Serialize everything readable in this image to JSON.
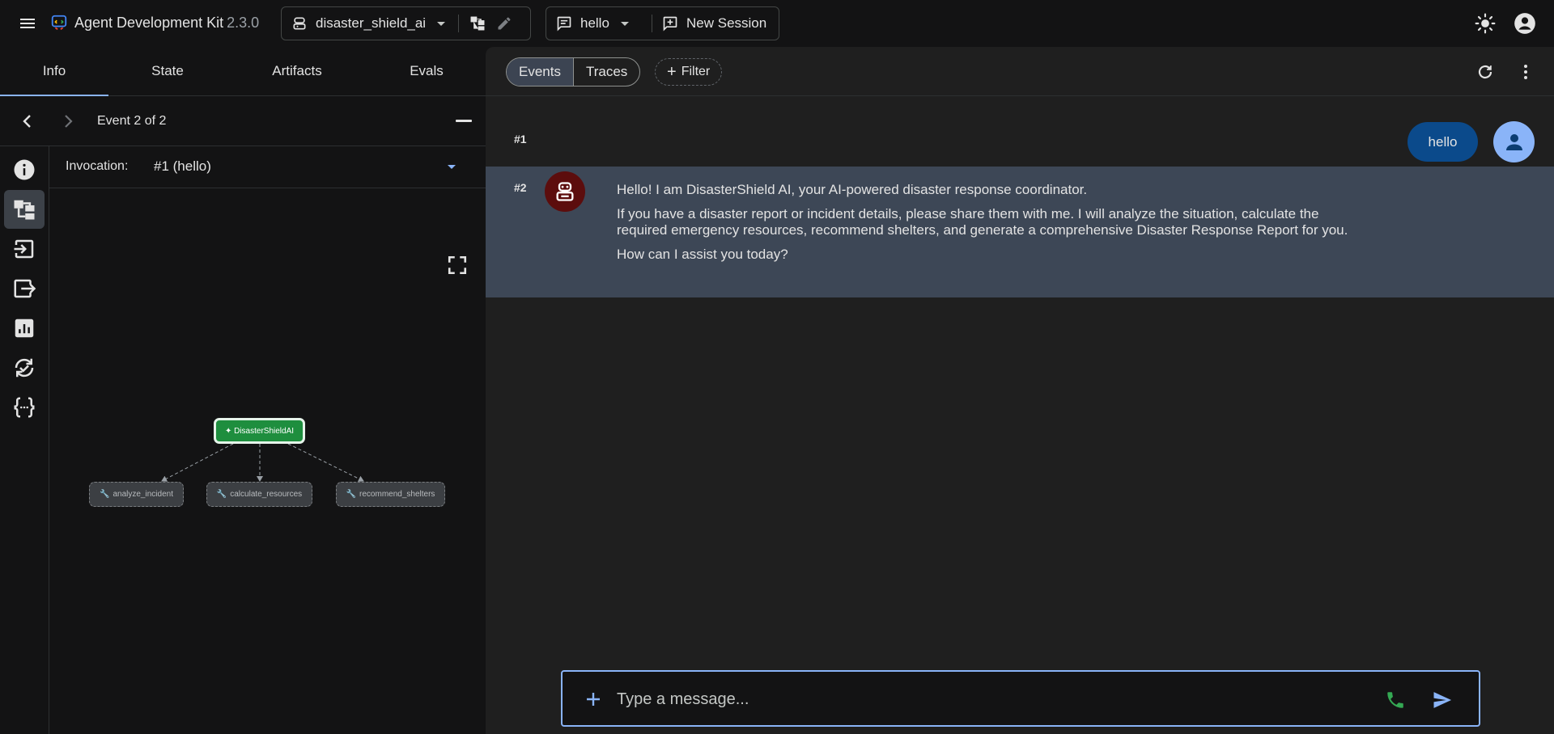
{
  "header": {
    "app_name": "Agent Development Kit",
    "version": "2.3.0",
    "agent": "disaster_shield_ai",
    "session": "hello",
    "new_session_label": "New Session"
  },
  "left": {
    "tabs": [
      {
        "label": "Info",
        "active": true
      },
      {
        "label": "State",
        "active": false
      },
      {
        "label": "Artifacts",
        "active": false
      },
      {
        "label": "Evals",
        "active": false
      }
    ],
    "event_label": "Event 2 of 2",
    "invocation_label": "Invocation:",
    "invocation_value": "#1 (hello)",
    "sidebar_icons": [
      "info-icon",
      "graph-icon",
      "input-icon",
      "output-icon",
      "stats-icon",
      "check-cycle-icon",
      "json-icon"
    ],
    "graph": {
      "root": "✦ DisasterShieldAI",
      "tools": [
        "analyze_incident",
        "calculate_resources",
        "recommend_shelters"
      ]
    }
  },
  "right": {
    "view_tabs": [
      {
        "label": "Events",
        "active": true
      },
      {
        "label": "Traces",
        "active": false
      }
    ],
    "filter_label": "Filter",
    "events": [
      {
        "num": "#1",
        "role": "user",
        "text": "hello"
      },
      {
        "num": "#2",
        "role": "agent",
        "paragraphs": [
          "Hello! I am DisasterShield AI, your AI-powered disaster response coordinator.",
          "If you have a disaster report or incident details, please share them with me. I will analyze the situation, calculate the required emergency resources, recommend shelters, and generate a comprehensive Disaster Response Report for you.",
          "How can I assist you today?"
        ]
      }
    ],
    "composer_placeholder": "Type a message..."
  },
  "colors": {
    "accent": "#8ab4f8",
    "agent_row": "#3d4756",
    "user_bubble": "#0b4a8b",
    "root_node": "#1e8e3e",
    "bot_avatar": "#5c0d0d",
    "call_green": "#34a853"
  }
}
